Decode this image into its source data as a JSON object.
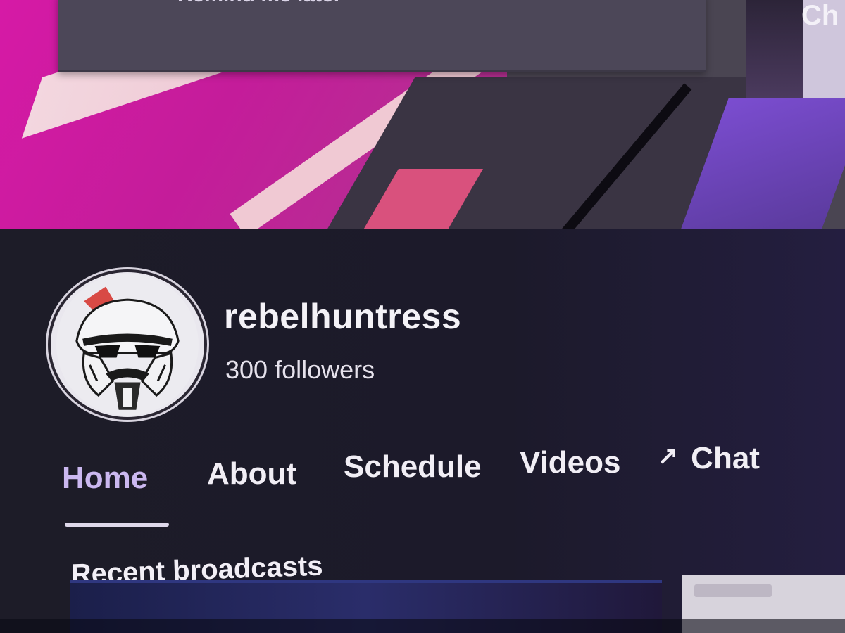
{
  "banner": {
    "reminder_label": "Remind me later",
    "corner_label": "Ch"
  },
  "channel": {
    "name": "rebelhuntress",
    "followers": "300 followers",
    "avatar": "stormtrooper-helmet-icon"
  },
  "tabs": [
    {
      "label": "Home",
      "active": true
    },
    {
      "label": "About",
      "active": false
    },
    {
      "label": "Schedule",
      "active": false
    },
    {
      "label": "Videos",
      "active": false
    },
    {
      "label": "Chat",
      "active": false,
      "icon": "external-arrow-icon",
      "icon_glyph": "↗"
    }
  ],
  "sections": {
    "recent_broadcasts_title": "Recent broadcasts"
  },
  "colors": {
    "panel_bg": "#1d1c28",
    "active_tab": "#cbb8f0",
    "banner_magenta": "#d61aa6"
  }
}
